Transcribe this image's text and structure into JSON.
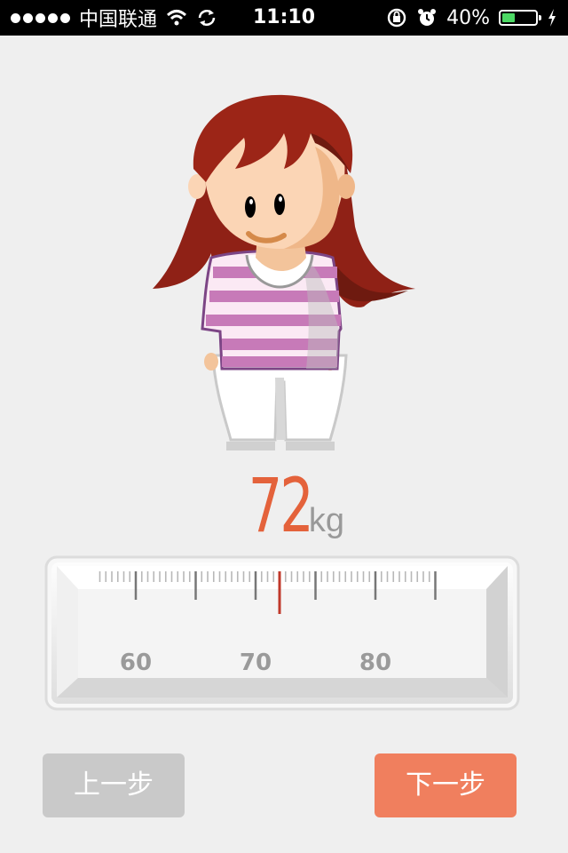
{
  "status_bar": {
    "carrier": "中国联通",
    "time": "11:10",
    "battery_percent": "40%",
    "battery_level": 0.4,
    "icons": [
      "signal-dots-icon",
      "wifi-icon",
      "sync-icon",
      "rotation-lock-icon",
      "alarm-icon",
      "battery-icon",
      "charging-icon"
    ]
  },
  "weight": {
    "value": "72",
    "unit": "kg"
  },
  "ruler": {
    "labels": [
      "60",
      "70",
      "80"
    ],
    "marker_color": "#c0392b"
  },
  "buttons": {
    "prev": "上一步",
    "next": "下一步"
  },
  "colors": {
    "accent": "#e4623b",
    "next_button": "#f07f5e",
    "prev_button": "#c9c9c9"
  }
}
